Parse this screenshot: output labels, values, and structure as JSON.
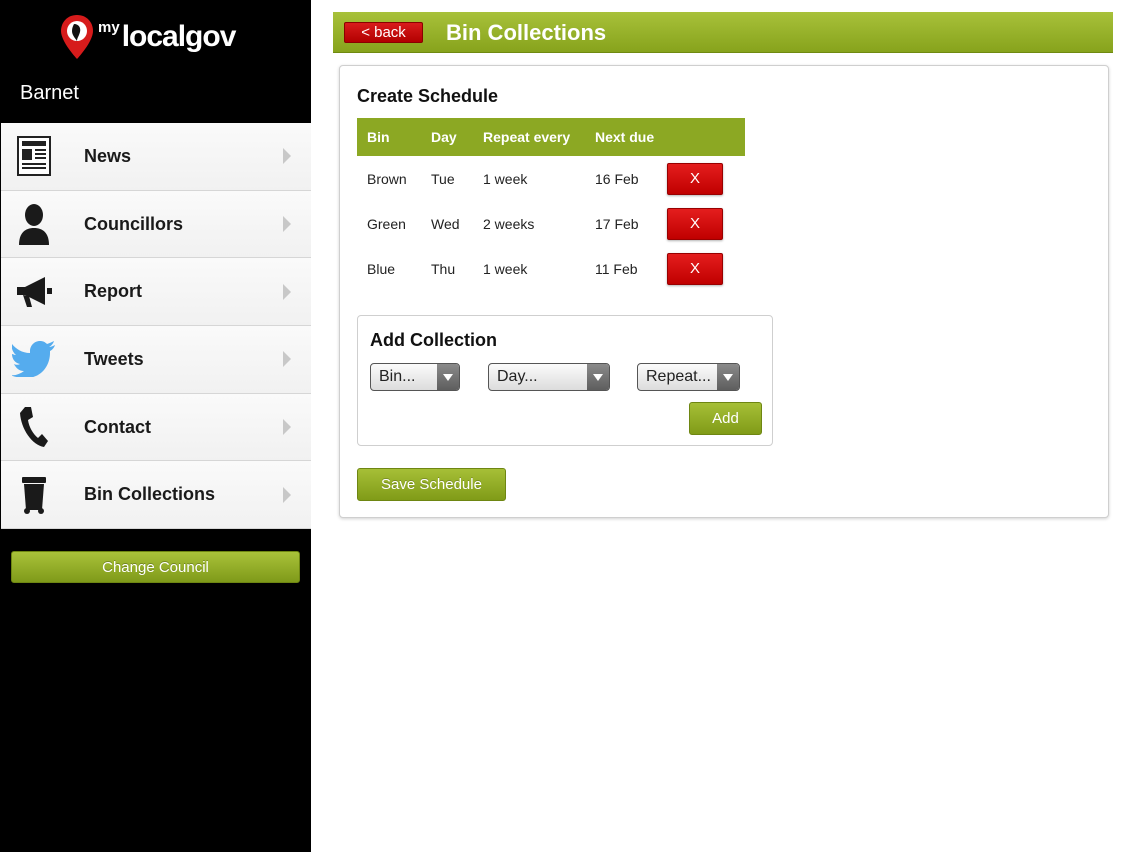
{
  "app": {
    "logo_prefix": "my",
    "logo_brand": "localgov",
    "council": "Barnet"
  },
  "sidebar": {
    "items": [
      {
        "label": "News",
        "icon": "newspaper-icon"
      },
      {
        "label": "Councillors",
        "icon": "person-icon"
      },
      {
        "label": "Report",
        "icon": "megaphone-icon"
      },
      {
        "label": "Tweets",
        "icon": "twitter-bird-icon"
      },
      {
        "label": "Contact",
        "icon": "phone-icon"
      },
      {
        "label": "Bin Collections",
        "icon": "wheelie-bin-icon"
      }
    ],
    "change_council_label": "Change Council"
  },
  "header": {
    "back_label": "< back",
    "title": "Bin Collections"
  },
  "schedule": {
    "title": "Create Schedule",
    "columns": [
      "Bin",
      "Day",
      "Repeat every",
      "Next due"
    ],
    "rows": [
      {
        "bin": "Brown",
        "day": "Tue",
        "repeat": "1 week",
        "next_due": "16 Feb",
        "delete_label": "X"
      },
      {
        "bin": "Green",
        "day": "Wed",
        "repeat": "2 weeks",
        "next_due": "17 Feb",
        "delete_label": "X"
      },
      {
        "bin": "Blue",
        "day": "Thu",
        "repeat": "1 week",
        "next_due": "11 Feb",
        "delete_label": "X"
      }
    ]
  },
  "add_collection": {
    "title": "Add Collection",
    "bin_select": "Bin...",
    "day_select": "Day...",
    "repeat_select": "Repeat...",
    "add_label": "Add"
  },
  "save_label": "Save Schedule",
  "colors": {
    "accent_green": "#8ca823",
    "delete_red": "#c00000",
    "sidebar_bg": "#000000"
  }
}
